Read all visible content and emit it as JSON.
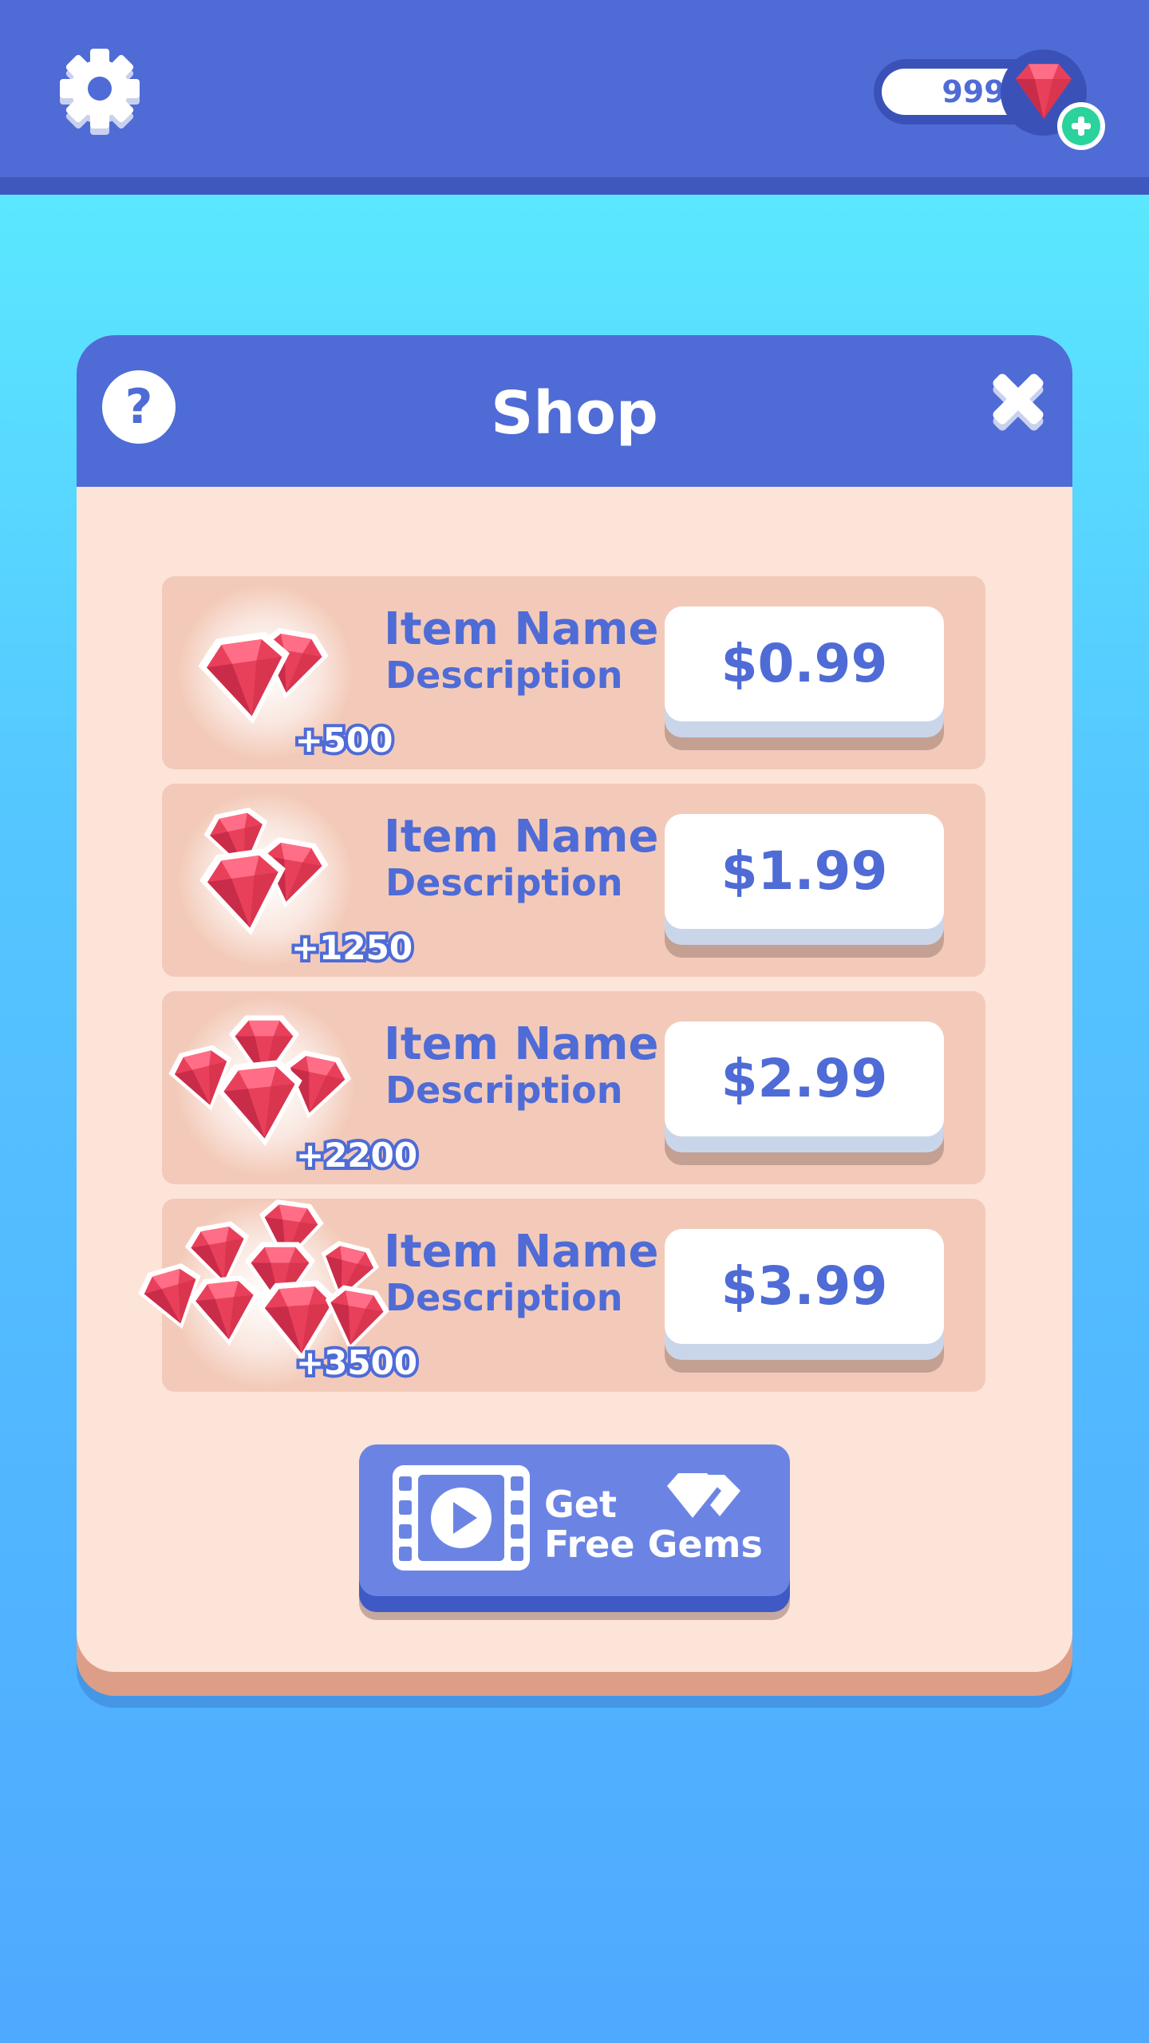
{
  "header": {
    "gem_count": "999"
  },
  "shop": {
    "title": "Shop",
    "items": [
      {
        "name": "Item Name",
        "description": "Description",
        "amount": "+500",
        "price": "$0.99"
      },
      {
        "name": "Item Name",
        "description": "Description",
        "amount": "+1250",
        "price": "$1.99"
      },
      {
        "name": "Item Name",
        "description": "Description",
        "amount": "+2200",
        "price": "$2.99"
      },
      {
        "name": "Item Name",
        "description": "Description",
        "amount": "+3500",
        "price": "$3.99"
      }
    ],
    "free_gems": {
      "line1": "Get",
      "line2": "Free Gems"
    }
  },
  "colors": {
    "primary_blue": "#4f6bd6",
    "panel": "#fde4d9",
    "item_row": "#f3cab9",
    "gem_red": "#e8405b",
    "plus_green": "#2ad39b"
  },
  "icons": [
    "gear-icon",
    "gem-icon",
    "plus-icon",
    "help-icon",
    "close-icon",
    "video-icon",
    "gems-icon"
  ]
}
